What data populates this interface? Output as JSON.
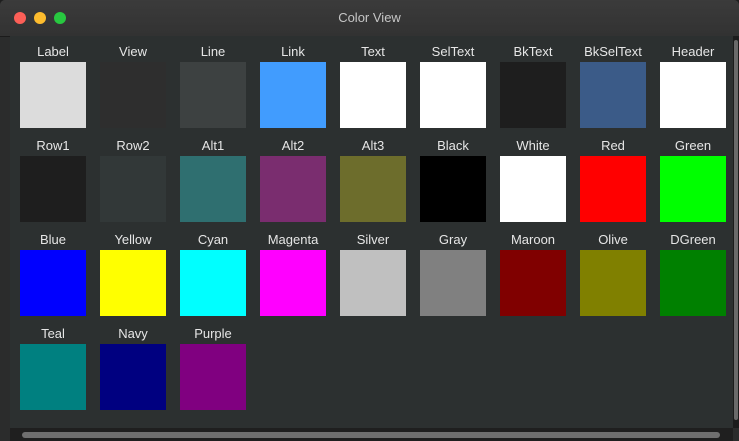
{
  "window": {
    "title": "Color View"
  },
  "swatches": [
    {
      "label": "Label",
      "color": "#dcdcdc"
    },
    {
      "label": "View",
      "color": "#2e2e2e"
    },
    {
      "label": "Line",
      "color": "#3d4141"
    },
    {
      "label": "Link",
      "color": "#419cfe"
    },
    {
      "label": "Text",
      "color": "#ffffff"
    },
    {
      "label": "SelText",
      "color": "#ffffff"
    },
    {
      "label": "BkText",
      "color": "#1e1e1e"
    },
    {
      "label": "BkSelText",
      "color": "#3b5b88"
    },
    {
      "label": "Header",
      "color": "#ffffff"
    },
    {
      "label": "Row1",
      "color": "#1e1e1e"
    },
    {
      "label": "Row2",
      "color": "#323838"
    },
    {
      "label": "Alt1",
      "color": "#2f6f70"
    },
    {
      "label": "Alt2",
      "color": "#7a2d6f"
    },
    {
      "label": "Alt3",
      "color": "#6d6d2c"
    },
    {
      "label": "Black",
      "color": "#000000"
    },
    {
      "label": "White",
      "color": "#ffffff"
    },
    {
      "label": "Red",
      "color": "#ff0000"
    },
    {
      "label": "Green",
      "color": "#00ff00"
    },
    {
      "label": "Blue",
      "color": "#0000ff"
    },
    {
      "label": "Yellow",
      "color": "#ffff00"
    },
    {
      "label": "Cyan",
      "color": "#00ffff"
    },
    {
      "label": "Magenta",
      "color": "#ff00ff"
    },
    {
      "label": "Silver",
      "color": "#c0c0c0"
    },
    {
      "label": "Gray",
      "color": "#808080"
    },
    {
      "label": "Maroon",
      "color": "#800000"
    },
    {
      "label": "Olive",
      "color": "#808000"
    },
    {
      "label": "DGreen",
      "color": "#008000"
    },
    {
      "label": "Teal",
      "color": "#008080"
    },
    {
      "label": "Navy",
      "color": "#000080"
    },
    {
      "label": "Purple",
      "color": "#800080"
    }
  ]
}
